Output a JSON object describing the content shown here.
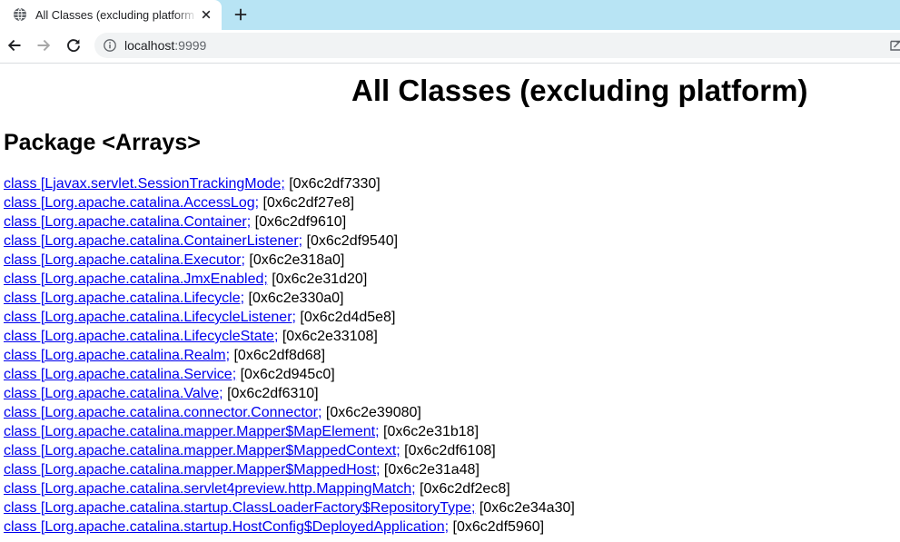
{
  "browser": {
    "tab": {
      "title": "All Classes (excluding platform",
      "favicon_icon": "globe-icon",
      "close_icon": "close-icon"
    },
    "new_tab_icon": "plus-icon",
    "toolbar": {
      "back_icon": "arrow-left-icon",
      "forward_icon": "arrow-right-icon",
      "reload_icon": "reload-icon"
    },
    "omnibox": {
      "site_info_icon": "info-icon",
      "host": "localhost",
      "port": ":9999",
      "trailing_icon": "install-app-icon"
    }
  },
  "page": {
    "title": "All Classes (excluding platform)",
    "package_heading": "Package <Arrays>",
    "classes": [
      {
        "name": "class [Ljavax.servlet.SessionTrackingMode;",
        "address": "[0x6c2df7330]"
      },
      {
        "name": "class [Lorg.apache.catalina.AccessLog;",
        "address": "[0x6c2df27e8]"
      },
      {
        "name": "class [Lorg.apache.catalina.Container;",
        "address": "[0x6c2df9610]"
      },
      {
        "name": "class [Lorg.apache.catalina.ContainerListener;",
        "address": "[0x6c2df9540]"
      },
      {
        "name": "class [Lorg.apache.catalina.Executor;",
        "address": "[0x6c2e318a0]"
      },
      {
        "name": "class [Lorg.apache.catalina.JmxEnabled;",
        "address": "[0x6c2e31d20]"
      },
      {
        "name": "class [Lorg.apache.catalina.Lifecycle;",
        "address": "[0x6c2e330a0]"
      },
      {
        "name": "class [Lorg.apache.catalina.LifecycleListener;",
        "address": "[0x6c2d4d5e8]"
      },
      {
        "name": "class [Lorg.apache.catalina.LifecycleState;",
        "address": "[0x6c2e33108]"
      },
      {
        "name": "class [Lorg.apache.catalina.Realm;",
        "address": "[0x6c2df8d68]"
      },
      {
        "name": "class [Lorg.apache.catalina.Service;",
        "address": "[0x6c2d945c0]"
      },
      {
        "name": "class [Lorg.apache.catalina.Valve;",
        "address": "[0x6c2df6310]"
      },
      {
        "name": "class [Lorg.apache.catalina.connector.Connector;",
        "address": "[0x6c2e39080]"
      },
      {
        "name": "class [Lorg.apache.catalina.mapper.Mapper$MapElement;",
        "address": "[0x6c2e31b18]"
      },
      {
        "name": "class [Lorg.apache.catalina.mapper.Mapper$MappedContext;",
        "address": "[0x6c2df6108]"
      },
      {
        "name": "class [Lorg.apache.catalina.mapper.Mapper$MappedHost;",
        "address": "[0x6c2e31a48]"
      },
      {
        "name": "class [Lorg.apache.catalina.servlet4preview.http.MappingMatch;",
        "address": "[0x6c2df2ec8]"
      },
      {
        "name": "class [Lorg.apache.catalina.startup.ClassLoaderFactory$RepositoryType;",
        "address": "[0x6c2e34a30]"
      },
      {
        "name": "class [Lorg.apache.catalina.startup.HostConfig$DeployedApplication;",
        "address": "[0x6c2df5960]"
      }
    ]
  },
  "colors": {
    "tabbar_background": "#b8e4f4",
    "tab_background": "#ffffff",
    "omnibox_background": "#f1f3f4",
    "url_primary": "#202124",
    "url_secondary": "#5f6368",
    "link": "#0000ee",
    "text": "#000000"
  }
}
